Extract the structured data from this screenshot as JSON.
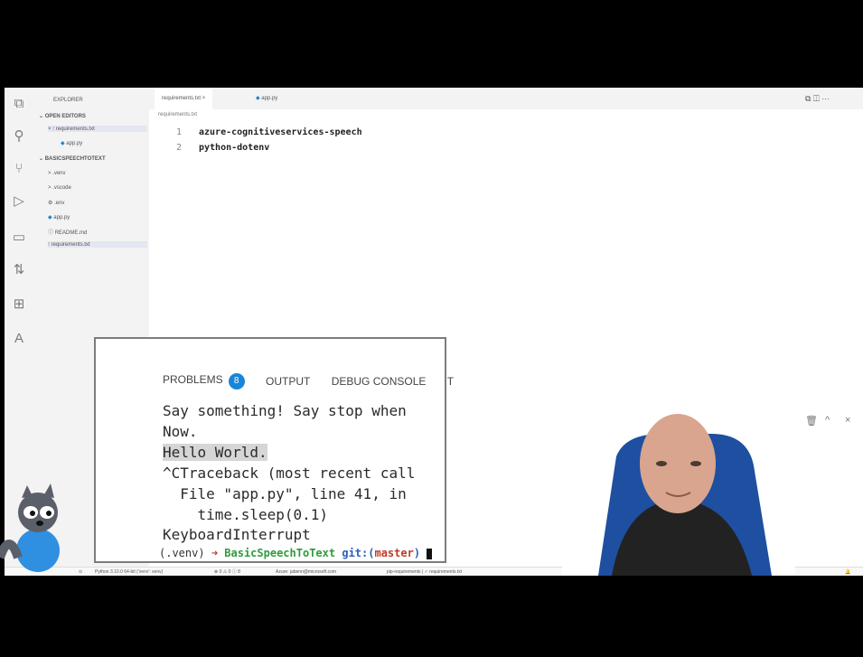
{
  "explorer": {
    "title": "EXPLORER",
    "open_editors": "OPEN EDITORS",
    "open_files": [
      "requirements.txt",
      "app.py"
    ],
    "folder": "BASICSPEECHTOTEXT",
    "items": [
      ".venv",
      ".vscode",
      ".env",
      "app.py",
      "README.md",
      "requirements.txt"
    ]
  },
  "tabs": [
    {
      "label": "requirements.txt",
      "close": "×",
      "active": true
    },
    {
      "label": "app.py",
      "active": false
    }
  ],
  "breadcrumb": "requirements.txt",
  "editor": {
    "lines": [
      {
        "num": "1",
        "text": "azure-cognitiveservices-speech"
      },
      {
        "num": "2",
        "text": "python-dotenv"
      }
    ]
  },
  "panel": {
    "tabs": [
      "PROBLEMS",
      "OUTPUT",
      "DEBUG CONSOLE",
      "T"
    ],
    "problems_count": "8",
    "icons": [
      "⌄",
      "+",
      "◫",
      "🗑",
      "^",
      "×"
    ]
  },
  "terminal": {
    "lines": [
      "Say something! Say stop when",
      "Now.",
      "Hello World.",
      "^CTraceback (most recent call",
      "  File \"app.py\", line 41, in",
      "    time.sleep(0.1)",
      "KeyboardInterrupt"
    ],
    "prompt_env": "(.venv)",
    "prompt_arrow": "➜",
    "prompt_dir": "BasicSpeechToText",
    "prompt_git": "git:(",
    "prompt_branch": "master",
    "prompt_close": ")"
  },
  "statusbar": {
    "python": "Python 3.10.0 64-bit ('venv': venv)",
    "problems": "⊗ 0 ⚠ 0 ⓘ 8",
    "azure": "Azure: jabenn@microsoft.com",
    "pip": "pip-requirements | ✓ requirements.txt"
  },
  "colors": {
    "accent": "#1a85d6",
    "prompt_green": "#2e9b3c",
    "prompt_red": "#c0392b",
    "bg": "#000000"
  }
}
